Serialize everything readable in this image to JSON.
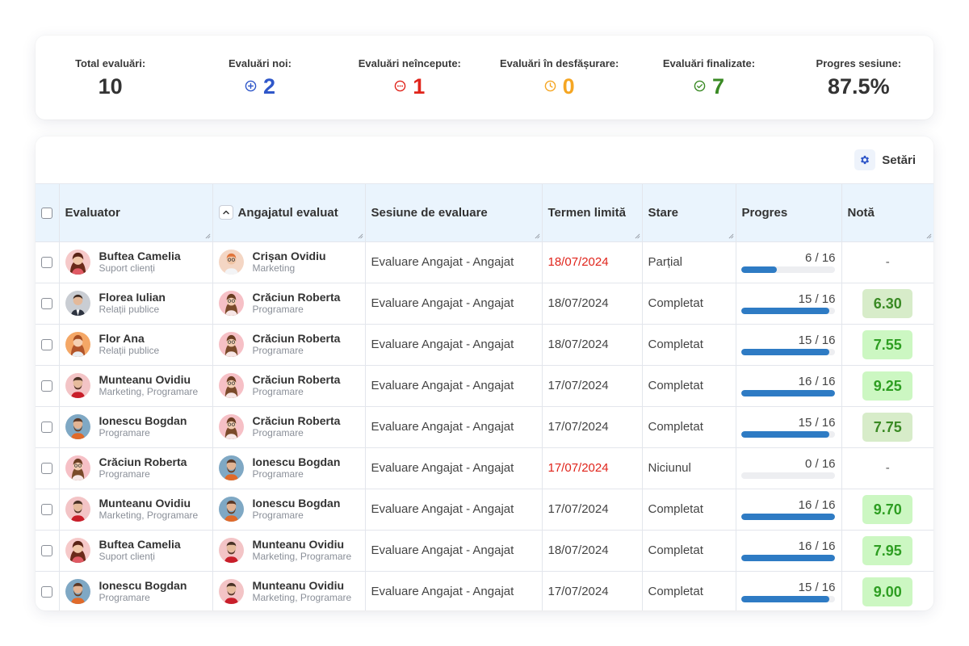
{
  "stats": [
    {
      "label": "Total evaluări:",
      "value": "10",
      "icon": "",
      "color": "#333333"
    },
    {
      "label": "Evaluări noi:",
      "value": "2",
      "icon": "plus-circle-icon",
      "color": "#2f57c9"
    },
    {
      "label": "Evaluări neîncepute:",
      "value": "1",
      "icon": "dots-circle-icon",
      "color": "#e0241b"
    },
    {
      "label": "Evaluări în desfășurare:",
      "value": "0",
      "icon": "clock-icon",
      "color": "#f5a623"
    },
    {
      "label": "Evaluări finalizate:",
      "value": "7",
      "icon": "check-circle-icon",
      "color": "#3a8a24"
    },
    {
      "label": "Progres sesiune:",
      "value": "87.5%",
      "icon": "",
      "color": "#333333"
    }
  ],
  "toolbar": {
    "settings_label": "Setări",
    "settings_icon": "gear-icon"
  },
  "table": {
    "columns": [
      "Evaluator",
      "Angajatul evaluat",
      "Sesiune de evaluare",
      "Termen limită",
      "Stare",
      "Progres",
      "Notă"
    ],
    "rows": [
      {
        "evaluator": {
          "name": "Buftea Camelia",
          "dept": "Suport clienți",
          "avatar": "f1"
        },
        "evaluated": {
          "name": "Crișan Ovidiu",
          "dept": "Marketing",
          "avatar": "m3"
        },
        "session": "Evaluare Angajat - Angajat",
        "deadline": "18/07/2024",
        "deadline_overdue": true,
        "status": "Parțial",
        "progress_text": "6 / 16",
        "progress": 0.375,
        "grade": "-",
        "grade_style": "none"
      },
      {
        "evaluator": {
          "name": "Florea Iulian",
          "dept": "Relații publice",
          "avatar": "m1"
        },
        "evaluated": {
          "name": "Crăciun Roberta",
          "dept": "Programare",
          "avatar": "f2"
        },
        "session": "Evaluare Angajat - Angajat",
        "deadline": "18/07/2024",
        "deadline_overdue": false,
        "status": "Completat",
        "progress_text": "15 / 16",
        "progress": 0.9375,
        "grade": "6.30",
        "grade_style": "muted"
      },
      {
        "evaluator": {
          "name": "Flor Ana",
          "dept": "Relații publice",
          "avatar": "f3"
        },
        "evaluated": {
          "name": "Crăciun Roberta",
          "dept": "Programare",
          "avatar": "f2"
        },
        "session": "Evaluare Angajat - Angajat",
        "deadline": "18/07/2024",
        "deadline_overdue": false,
        "status": "Completat",
        "progress_text": "15 / 16",
        "progress": 0.9375,
        "grade": "7.55",
        "grade_style": "strong"
      },
      {
        "evaluator": {
          "name": "Munteanu Ovidiu",
          "dept": "Marketing, Programare",
          "avatar": "m2"
        },
        "evaluated": {
          "name": "Crăciun Roberta",
          "dept": "Programare",
          "avatar": "f2"
        },
        "session": "Evaluare Angajat - Angajat",
        "deadline": "17/07/2024",
        "deadline_overdue": false,
        "status": "Completat",
        "progress_text": "16 / 16",
        "progress": 1.0,
        "grade": "9.25",
        "grade_style": "strong"
      },
      {
        "evaluator": {
          "name": "Ionescu Bogdan",
          "dept": "Programare",
          "avatar": "m4"
        },
        "evaluated": {
          "name": "Crăciun Roberta",
          "dept": "Programare",
          "avatar": "f2"
        },
        "session": "Evaluare Angajat - Angajat",
        "deadline": "17/07/2024",
        "deadline_overdue": false,
        "status": "Completat",
        "progress_text": "15 / 16",
        "progress": 0.9375,
        "grade": "7.75",
        "grade_style": "muted"
      },
      {
        "evaluator": {
          "name": "Crăciun Roberta",
          "dept": "Programare",
          "avatar": "f2"
        },
        "evaluated": {
          "name": "Ionescu Bogdan",
          "dept": "Programare",
          "avatar": "m4"
        },
        "session": "Evaluare Angajat - Angajat",
        "deadline": "17/07/2024",
        "deadline_overdue": true,
        "status": "Niciunul",
        "progress_text": "0 / 16",
        "progress": 0.0,
        "grade": "-",
        "grade_style": "none"
      },
      {
        "evaluator": {
          "name": "Munteanu Ovidiu",
          "dept": "Marketing, Programare",
          "avatar": "m2"
        },
        "evaluated": {
          "name": "Ionescu Bogdan",
          "dept": "Programare",
          "avatar": "m4"
        },
        "session": "Evaluare Angajat - Angajat",
        "deadline": "17/07/2024",
        "deadline_overdue": false,
        "status": "Completat",
        "progress_text": "16 / 16",
        "progress": 1.0,
        "grade": "9.70",
        "grade_style": "strong"
      },
      {
        "evaluator": {
          "name": "Buftea Camelia",
          "dept": "Suport clienți",
          "avatar": "f1"
        },
        "evaluated": {
          "name": "Munteanu Ovidiu",
          "dept": "Marketing, Programare",
          "avatar": "m2"
        },
        "session": "Evaluare Angajat - Angajat",
        "deadline": "18/07/2024",
        "deadline_overdue": false,
        "status": "Completat",
        "progress_text": "16 / 16",
        "progress": 1.0,
        "grade": "7.95",
        "grade_style": "strong"
      },
      {
        "evaluator": {
          "name": "Ionescu Bogdan",
          "dept": "Programare",
          "avatar": "m4"
        },
        "evaluated": {
          "name": "Munteanu Ovidiu",
          "dept": "Marketing, Programare",
          "avatar": "m2"
        },
        "session": "Evaluare Angajat - Angajat",
        "deadline": "17/07/2024",
        "deadline_overdue": false,
        "status": "Completat",
        "progress_text": "15 / 16",
        "progress": 0.9375,
        "grade": "9.00",
        "grade_style": "strong"
      }
    ]
  }
}
